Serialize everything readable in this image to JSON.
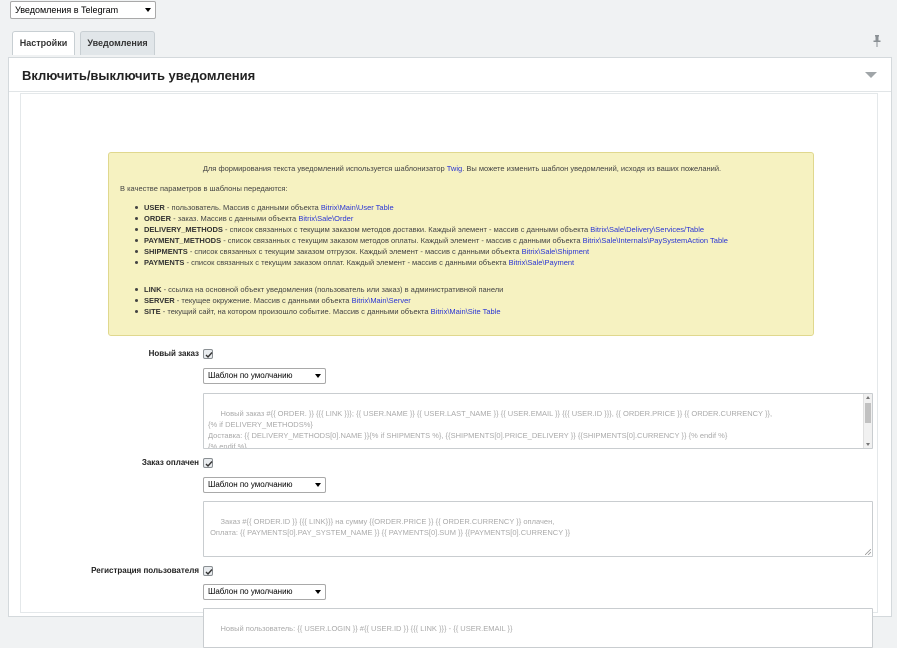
{
  "top_select": {
    "value": "Уведомления в Telegram"
  },
  "tabs": [
    {
      "label": "Настройки"
    },
    {
      "label": "Уведомления"
    }
  ],
  "section": {
    "title": "Включить/выключить уведомления"
  },
  "info": {
    "intro_before": "Для формирования текста уведомлений используется шаблонизатор ",
    "intro_link": "Twig",
    "intro_after": ". Вы можете изменить шаблон уведомлений, исходя из ваших пожеланий.",
    "params_intro": "В качестве параметров в шаблоны передаются:",
    "params": [
      {
        "key": "USER",
        "desc": " - пользователь. Массив с данными объекта ",
        "link": "Bitrix\\Main\\User Table"
      },
      {
        "key": "ORDER",
        "desc": " - заказ. Массив с данными объекта ",
        "link": "Bitrix\\Sale\\Order"
      },
      {
        "key": "DELIVERY_METHODS",
        "desc": " - список связанных с текущим заказом методов доставки. Каждый элемент - массив с данными объекта ",
        "link": "Bitrix\\Sale\\Delivery\\Services/Table"
      },
      {
        "key": "PAYMENT_METHODS",
        "desc": " - список связанных с текущим заказом методов оплаты. Каждый элемент - массив с данными объекта ",
        "link": "Bitrix\\Sale\\Internals\\PaySystemAction Table"
      },
      {
        "key": "SHIPMENTS",
        "desc": " - список связанных с текущим заказом отгрузок. Каждый элемент - массив с данными объекта ",
        "link": "Bitrix\\Sale\\Shipment"
      },
      {
        "key": "PAYMENTS",
        "desc": " - список связанных с текущим заказом оплат. Каждый элемент - массив с данными объекта ",
        "link": "Bitrix\\Sale\\Payment"
      }
    ],
    "extra": [
      {
        "key": "LINK",
        "desc": " - ссылка на основной объект уведомления (пользователь или заказ) в административной панели",
        "link": ""
      },
      {
        "key": "SERVER",
        "desc": " - текущее окружение. Массив с данными объекта ",
        "link": "Bitrix\\Main\\Server"
      },
      {
        "key": "SITE",
        "desc": " - текущий сайт, на котором произошло событие. Массив с данными объекта  ",
        "link": "Bitrix\\Main\\Site Table"
      }
    ]
  },
  "fields": [
    {
      "label": "Новый заказ",
      "checked": true,
      "template_select": "Шаблон по умолчанию",
      "template_text": "Новый заказ #{{ ORDER. }} {{{ LINK }}}; {{ USER.NAME }} {{ USER.LAST_NAME }} {{ USER.EMAIL }} {{{ USER.ID }}}, {{ ORDER.PRICE }} {{ ORDER.CURRENCY }},\n{% if DELIVERY_METHODS%}\nДоставка: {{ DELIVERY_METHODS[0].NAME }}{% if SHIPMENTS %}, {{SHIPMENTS[0].PRICE_DELIVERY }} {{SHIPMENTS[0].CURRENCY }} {% endif %}\n{% endif %}\n{% if PAYMENT_METHODS %}"
    },
    {
      "label": "Заказ оплачен",
      "checked": true,
      "template_select": "Шаблон по умолчанию",
      "template_text": "Заказ #{{ ORDER.ID }} {{{ LINK}}} на сумму {{ORDER.PRICE }} {{ ORDER.CURRENCY }} оплачен,\n Оплата: {{ PAYMENTS[0].PAY_SYSTEM_NAME }} {{ PAYMENTS[0].SUM }} {{PAYMENTS[0].CURRENCY }}"
    },
    {
      "label": "Регистрация пользователя",
      "checked": true,
      "template_select": "Шаблон по умолчанию",
      "template_text": "Новый пользователь: {{ USER.LOGIN }} #{{ USER.ID }} {{{ LINK }}} - {{ USER.EMAIL }}"
    }
  ],
  "colors": {
    "link": "#2a35d4",
    "info_bg": "#f6f2c1",
    "page_bg": "#f0f2f3"
  }
}
